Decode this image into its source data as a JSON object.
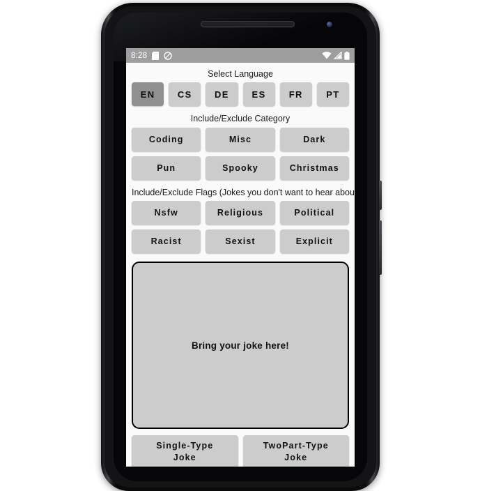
{
  "status_bar": {
    "time": "8:28",
    "icons_left": [
      "sim-card-icon",
      "do-not-disturb-icon"
    ],
    "icons_right": [
      "wifi-icon",
      "cellular-signal-icon",
      "battery-icon"
    ]
  },
  "sections": {
    "language": {
      "label": "Select Language",
      "buttons": [
        {
          "label": "EN",
          "selected": true
        },
        {
          "label": "CS",
          "selected": false
        },
        {
          "label": "DE",
          "selected": false
        },
        {
          "label": "ES",
          "selected": false
        },
        {
          "label": "FR",
          "selected": false
        },
        {
          "label": "PT",
          "selected": false
        }
      ]
    },
    "category": {
      "label": "Include/Exclude Category",
      "row1": [
        {
          "label": "Coding"
        },
        {
          "label": "Misc"
        },
        {
          "label": "Dark"
        }
      ],
      "row2": [
        {
          "label": "Pun"
        },
        {
          "label": "Spooky"
        },
        {
          "label": "Christmas"
        }
      ]
    },
    "flags": {
      "label": "Include/Exclude Flags (Jokes you don't want to hear about)",
      "row1": [
        {
          "label": "Nsfw"
        },
        {
          "label": "Religious"
        },
        {
          "label": "Political"
        }
      ],
      "row2": [
        {
          "label": "Racist"
        },
        {
          "label": "Sexist"
        },
        {
          "label": "Explicit"
        }
      ]
    },
    "joke_display": {
      "text": "Bring your joke here!"
    },
    "actions": [
      {
        "line1": "Single-Type",
        "line2": "Joke"
      },
      {
        "line1": "TwoPart-Type",
        "line2": "Joke"
      }
    ]
  },
  "colors": {
    "status_bar_bg": "#9e9e9e",
    "app_bg": "#fafafa",
    "button_bg": "#cccccc",
    "button_selected_bg": "#909090",
    "text": "#111111",
    "joke_border": "#000000"
  }
}
